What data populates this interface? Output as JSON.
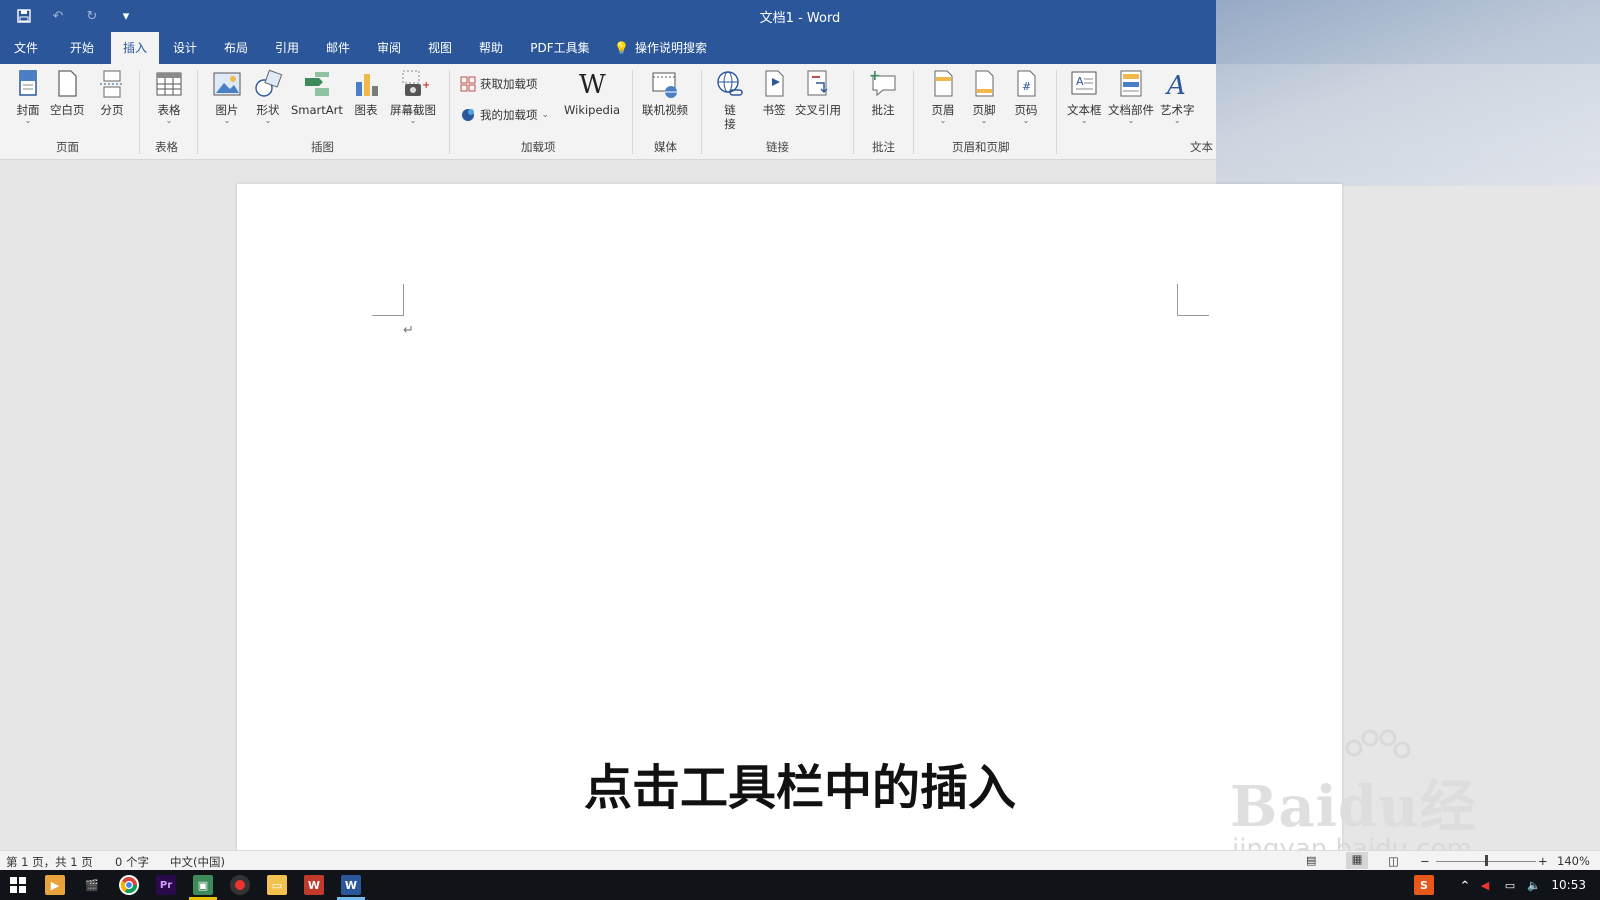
{
  "window": {
    "title": "文档1  -  Word"
  },
  "tabs": [
    {
      "label": "文件"
    },
    {
      "label": "开始"
    },
    {
      "label": "插入"
    },
    {
      "label": "设计"
    },
    {
      "label": "布局"
    },
    {
      "label": "引用"
    },
    {
      "label": "邮件"
    },
    {
      "label": "审阅"
    },
    {
      "label": "视图"
    },
    {
      "label": "帮助"
    },
    {
      "label": "PDF工具集"
    }
  ],
  "active_tab": "插入",
  "tell_me": "操作说明搜索",
  "ribbon": {
    "groups": {
      "pages": "页面",
      "tables": "表格",
      "illustrations": "插图",
      "addins": "加载项",
      "media": "媒体",
      "links": "链接",
      "comments": "批注",
      "header_footer": "页眉和页脚",
      "text": "文本"
    },
    "buttons": {
      "cover": "封面",
      "blank": "空白页",
      "pagebreak": "分页",
      "table": "表格",
      "picture": "图片",
      "shapes": "形状",
      "smartart": "SmartArt",
      "chart": "图表",
      "screenshot": "屏幕截图",
      "get_addins": "获取加载项",
      "my_addins": "我的加载项",
      "wikipedia": "Wikipedia",
      "online_video": "联机视频",
      "link": "链\n接",
      "bookmark": "书签",
      "crossref": "交叉引用",
      "comment": "批注",
      "header": "页眉",
      "footer": "页脚",
      "pagenum": "页码",
      "textbox": "文本框",
      "quickparts": "文档部件",
      "wordart": "艺术字"
    }
  },
  "document": {
    "paragraph_mark": "↵"
  },
  "caption": "点击工具栏中的插入",
  "watermark": {
    "logo": "Baidu经验",
    "sub": "jingyan.baidu.com"
  },
  "status": {
    "page": "第 1 页，共 1 页",
    "words": "0 个字",
    "language": "中文(中国)",
    "zoom": "140%"
  },
  "taskbar": {
    "time": "10:53"
  },
  "colors": {
    "word_blue": "#2b579a",
    "ribbon_bg": "#f3f3f3"
  }
}
